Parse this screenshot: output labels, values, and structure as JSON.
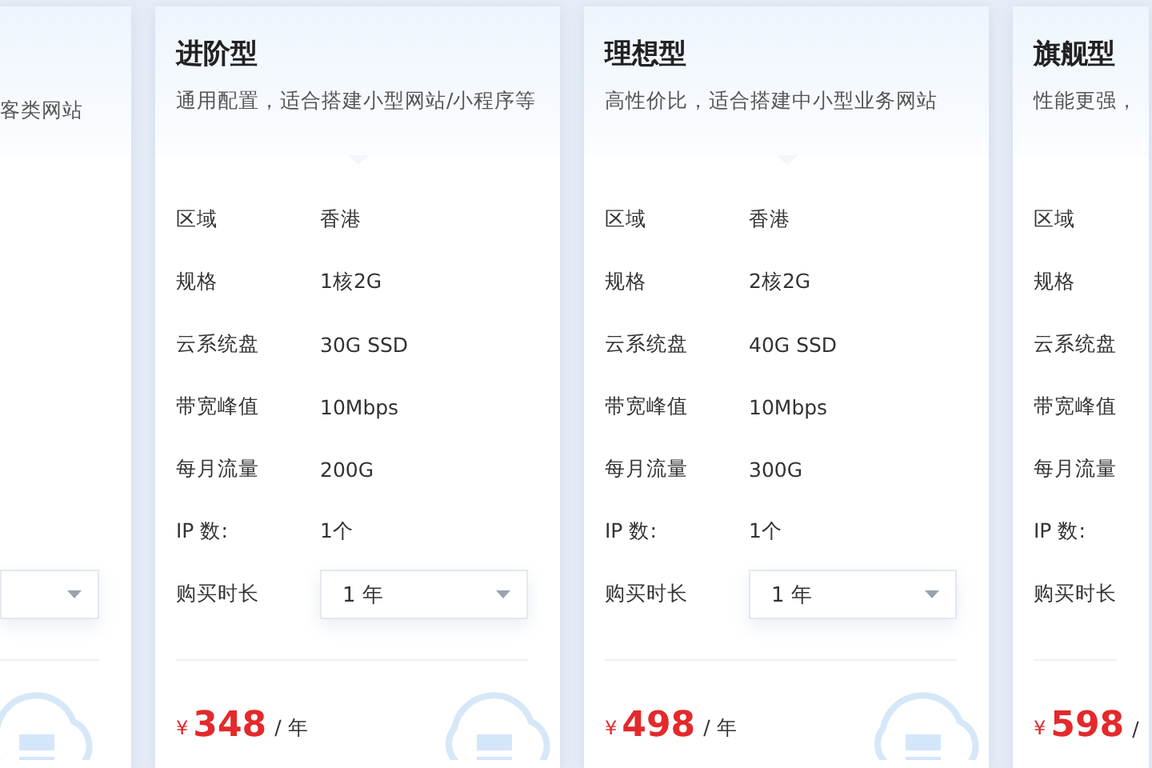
{
  "cards": [
    {
      "kind": "left",
      "description": "客类网站"
    },
    {
      "kind": "full",
      "title": "进阶型",
      "description": "通用配置，适合搭建小型网站/小程序等",
      "specs": [
        {
          "label": "区域",
          "value": "香港"
        },
        {
          "label": "规格",
          "value": "1核2G"
        },
        {
          "label": "云系统盘",
          "value": "30G SSD"
        },
        {
          "label": "带宽峰值",
          "value": "10Mbps"
        },
        {
          "label": "每月流量",
          "value": "200G"
        },
        {
          "label": "IP 数:",
          "value": "1个"
        }
      ],
      "duration": {
        "label": "购买时长",
        "value": "1 年"
      },
      "price": {
        "currency": "¥",
        "amount": "348",
        "unit": "/ 年"
      }
    },
    {
      "kind": "full",
      "title": "理想型",
      "description": "高性价比，适合搭建中小型业务网站",
      "specs": [
        {
          "label": "区域",
          "value": "香港"
        },
        {
          "label": "规格",
          "value": "2核2G"
        },
        {
          "label": "云系统盘",
          "value": "40G SSD"
        },
        {
          "label": "带宽峰值",
          "value": "10Mbps"
        },
        {
          "label": "每月流量",
          "value": "300G"
        },
        {
          "label": "IP 数:",
          "value": "1个"
        }
      ],
      "duration": {
        "label": "购买时长",
        "value": "1 年"
      },
      "price": {
        "currency": "¥",
        "amount": "498",
        "unit": "/ 年"
      }
    },
    {
      "kind": "right",
      "title": "旗舰型",
      "description": "性能更强，",
      "specs": [
        {
          "label": "区域"
        },
        {
          "label": "规格"
        },
        {
          "label": "云系统盘"
        },
        {
          "label": "带宽峰值"
        },
        {
          "label": "每月流量"
        },
        {
          "label": "IP 数:"
        }
      ],
      "duration": {
        "label": "购买时长"
      },
      "price": {
        "currency": "¥",
        "amount": "598",
        "unit": "/"
      }
    }
  ]
}
